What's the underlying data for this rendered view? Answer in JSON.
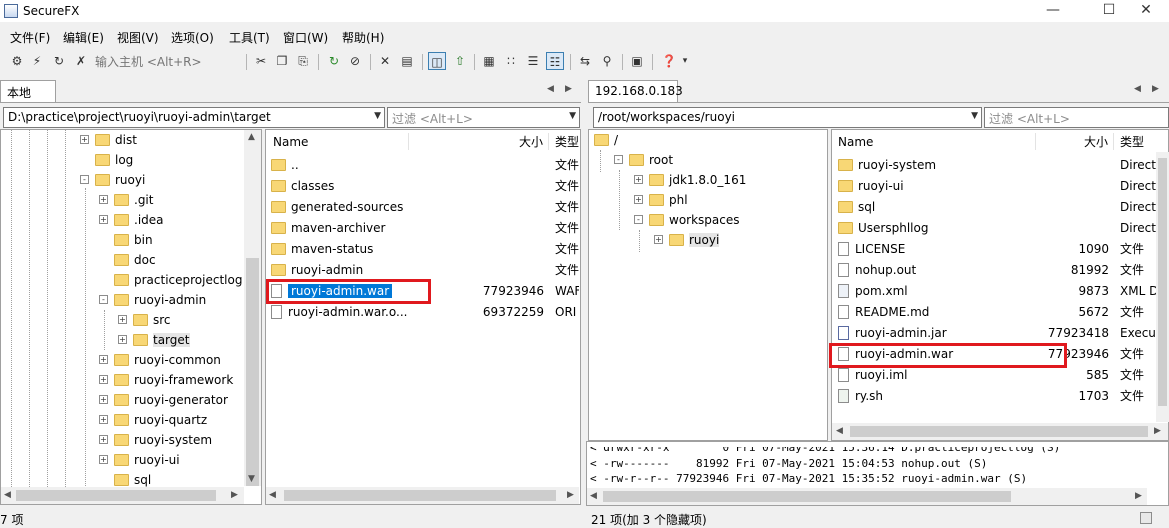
{
  "window": {
    "title": "SecureFX"
  },
  "menu": [
    "文件(F)",
    "编辑(E)",
    "视图(V)",
    "选项(O)",
    "工具(T)",
    "窗口(W)",
    "帮助(H)"
  ],
  "toolbar": {
    "host_placeholder": "输入主机 <Alt+R>"
  },
  "left": {
    "tab": "本地",
    "path": "D:\\practice\\project\\ruoyi\\ruoyi-admin\\target",
    "filter_placeholder": "过滤 <Alt+L>",
    "tree": [
      {
        "label": "dist",
        "exp": "+"
      },
      {
        "label": "log",
        "exp": ""
      },
      {
        "label": "ruoyi",
        "exp": "-"
      },
      {
        "label": ".git",
        "exp": "+"
      },
      {
        "label": ".idea",
        "exp": "+"
      },
      {
        "label": "bin",
        "exp": ""
      },
      {
        "label": "doc",
        "exp": ""
      },
      {
        "label": "practiceprojectlog",
        "exp": ""
      },
      {
        "label": "ruoyi-admin",
        "exp": "-"
      },
      {
        "label": "src",
        "exp": "+"
      },
      {
        "label": "target",
        "exp": "+"
      },
      {
        "label": "ruoyi-common",
        "exp": "+"
      },
      {
        "label": "ruoyi-framework",
        "exp": "+"
      },
      {
        "label": "ruoyi-generator",
        "exp": "+"
      },
      {
        "label": "ruoyi-quartz",
        "exp": "+"
      },
      {
        "label": "ruoyi-system",
        "exp": "+"
      },
      {
        "label": "ruoyi-ui",
        "exp": "+"
      },
      {
        "label": "sql",
        "exp": ""
      }
    ],
    "headers": {
      "name": "Name",
      "size": "大小",
      "type": "类型"
    },
    "files": [
      {
        "name": "..",
        "size": "",
        "type": "文件",
        "icon": "folder"
      },
      {
        "name": "classes",
        "size": "",
        "type": "文件",
        "icon": "folder"
      },
      {
        "name": "generated-sources",
        "size": "",
        "type": "文件",
        "icon": "folder"
      },
      {
        "name": "maven-archiver",
        "size": "",
        "type": "文件",
        "icon": "folder"
      },
      {
        "name": "maven-status",
        "size": "",
        "type": "文件",
        "icon": "folder"
      },
      {
        "name": "ruoyi-admin",
        "size": "",
        "type": "文件",
        "icon": "folder"
      },
      {
        "name": "ruoyi-admin.war",
        "size": "77923946",
        "type": "WAF",
        "icon": "file"
      },
      {
        "name": "ruoyi-admin.war.o...",
        "size": "69372259",
        "type": "ORI",
        "icon": "file"
      }
    ],
    "status": "7 项"
  },
  "right": {
    "tab": "192.168.0.183",
    "path": "/root/workspaces/ruoyi",
    "filter_placeholder": "过滤 <Alt+L>",
    "tree": [
      {
        "label": "/",
        "exp": "-"
      },
      {
        "label": "root",
        "exp": "-"
      },
      {
        "label": "jdk1.8.0_161",
        "exp": "+"
      },
      {
        "label": "phl",
        "exp": "+"
      },
      {
        "label": "workspaces",
        "exp": "-"
      },
      {
        "label": "ruoyi",
        "exp": "+"
      }
    ],
    "headers": {
      "name": "Name",
      "size": "大小",
      "type": "类型"
    },
    "files": [
      {
        "name": "ruoyi-system",
        "size": "",
        "type": "Directo",
        "icon": "folder"
      },
      {
        "name": "ruoyi-ui",
        "size": "",
        "type": "Directo",
        "icon": "folder"
      },
      {
        "name": "sql",
        "size": "",
        "type": "Directo",
        "icon": "folder"
      },
      {
        "name": "Usersphllog",
        "size": "",
        "type": "Directo",
        "icon": "folder"
      },
      {
        "name": "LICENSE",
        "size": "1090",
        "type": "文件",
        "icon": "file"
      },
      {
        "name": "nohup.out",
        "size": "81992",
        "type": "文件",
        "icon": "file"
      },
      {
        "name": "pom.xml",
        "size": "9873",
        "type": "XML D",
        "icon": "xml"
      },
      {
        "name": "README.md",
        "size": "5672",
        "type": "文件",
        "icon": "file"
      },
      {
        "name": "ruoyi-admin.jar",
        "size": "77923418",
        "type": "Executa",
        "icon": "jar"
      },
      {
        "name": "ruoyi-admin.war",
        "size": "77923946",
        "type": "文件",
        "icon": "file"
      },
      {
        "name": "ruoyi.iml",
        "size": "585",
        "type": "文件",
        "icon": "file"
      },
      {
        "name": "ry.sh",
        "size": "1703",
        "type": "文件",
        "icon": "sh"
      }
    ],
    "log": [
      "< drwxr-xr-x        0 Fri 07-May-2021 15:36:14 D:practiceprojectlog (S)",
      "< -rw-------    81992 Fri 07-May-2021 15:04:53 nohup.out (S)",
      "< -rw-r--r-- 77923946 Fri 07-May-2021 15:35:52 ruoyi-admin.war (S)"
    ],
    "status": "21 项(加 3 个隐藏项)"
  }
}
